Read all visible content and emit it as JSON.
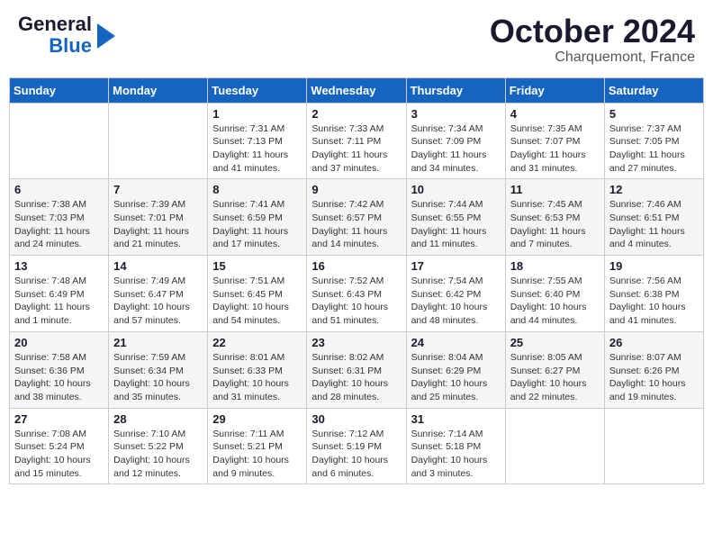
{
  "header": {
    "logo_general": "General",
    "logo_blue": "Blue",
    "month_title": "October 2024",
    "location": "Charquemont, France"
  },
  "days_of_week": [
    "Sunday",
    "Monday",
    "Tuesday",
    "Wednesday",
    "Thursday",
    "Friday",
    "Saturday"
  ],
  "weeks": [
    [
      {
        "day": "",
        "info": ""
      },
      {
        "day": "",
        "info": ""
      },
      {
        "day": "1",
        "info": "Sunrise: 7:31 AM\nSunset: 7:13 PM\nDaylight: 11 hours and 41 minutes."
      },
      {
        "day": "2",
        "info": "Sunrise: 7:33 AM\nSunset: 7:11 PM\nDaylight: 11 hours and 37 minutes."
      },
      {
        "day": "3",
        "info": "Sunrise: 7:34 AM\nSunset: 7:09 PM\nDaylight: 11 hours and 34 minutes."
      },
      {
        "day": "4",
        "info": "Sunrise: 7:35 AM\nSunset: 7:07 PM\nDaylight: 11 hours and 31 minutes."
      },
      {
        "day": "5",
        "info": "Sunrise: 7:37 AM\nSunset: 7:05 PM\nDaylight: 11 hours and 27 minutes."
      }
    ],
    [
      {
        "day": "6",
        "info": "Sunrise: 7:38 AM\nSunset: 7:03 PM\nDaylight: 11 hours and 24 minutes."
      },
      {
        "day": "7",
        "info": "Sunrise: 7:39 AM\nSunset: 7:01 PM\nDaylight: 11 hours and 21 minutes."
      },
      {
        "day": "8",
        "info": "Sunrise: 7:41 AM\nSunset: 6:59 PM\nDaylight: 11 hours and 17 minutes."
      },
      {
        "day": "9",
        "info": "Sunrise: 7:42 AM\nSunset: 6:57 PM\nDaylight: 11 hours and 14 minutes."
      },
      {
        "day": "10",
        "info": "Sunrise: 7:44 AM\nSunset: 6:55 PM\nDaylight: 11 hours and 11 minutes."
      },
      {
        "day": "11",
        "info": "Sunrise: 7:45 AM\nSunset: 6:53 PM\nDaylight: 11 hours and 7 minutes."
      },
      {
        "day": "12",
        "info": "Sunrise: 7:46 AM\nSunset: 6:51 PM\nDaylight: 11 hours and 4 minutes."
      }
    ],
    [
      {
        "day": "13",
        "info": "Sunrise: 7:48 AM\nSunset: 6:49 PM\nDaylight: 11 hours and 1 minute."
      },
      {
        "day": "14",
        "info": "Sunrise: 7:49 AM\nSunset: 6:47 PM\nDaylight: 10 hours and 57 minutes."
      },
      {
        "day": "15",
        "info": "Sunrise: 7:51 AM\nSunset: 6:45 PM\nDaylight: 10 hours and 54 minutes."
      },
      {
        "day": "16",
        "info": "Sunrise: 7:52 AM\nSunset: 6:43 PM\nDaylight: 10 hours and 51 minutes."
      },
      {
        "day": "17",
        "info": "Sunrise: 7:54 AM\nSunset: 6:42 PM\nDaylight: 10 hours and 48 minutes."
      },
      {
        "day": "18",
        "info": "Sunrise: 7:55 AM\nSunset: 6:40 PM\nDaylight: 10 hours and 44 minutes."
      },
      {
        "day": "19",
        "info": "Sunrise: 7:56 AM\nSunset: 6:38 PM\nDaylight: 10 hours and 41 minutes."
      }
    ],
    [
      {
        "day": "20",
        "info": "Sunrise: 7:58 AM\nSunset: 6:36 PM\nDaylight: 10 hours and 38 minutes."
      },
      {
        "day": "21",
        "info": "Sunrise: 7:59 AM\nSunset: 6:34 PM\nDaylight: 10 hours and 35 minutes."
      },
      {
        "day": "22",
        "info": "Sunrise: 8:01 AM\nSunset: 6:33 PM\nDaylight: 10 hours and 31 minutes."
      },
      {
        "day": "23",
        "info": "Sunrise: 8:02 AM\nSunset: 6:31 PM\nDaylight: 10 hours and 28 minutes."
      },
      {
        "day": "24",
        "info": "Sunrise: 8:04 AM\nSunset: 6:29 PM\nDaylight: 10 hours and 25 minutes."
      },
      {
        "day": "25",
        "info": "Sunrise: 8:05 AM\nSunset: 6:27 PM\nDaylight: 10 hours and 22 minutes."
      },
      {
        "day": "26",
        "info": "Sunrise: 8:07 AM\nSunset: 6:26 PM\nDaylight: 10 hours and 19 minutes."
      }
    ],
    [
      {
        "day": "27",
        "info": "Sunrise: 7:08 AM\nSunset: 5:24 PM\nDaylight: 10 hours and 15 minutes."
      },
      {
        "day": "28",
        "info": "Sunrise: 7:10 AM\nSunset: 5:22 PM\nDaylight: 10 hours and 12 minutes."
      },
      {
        "day": "29",
        "info": "Sunrise: 7:11 AM\nSunset: 5:21 PM\nDaylight: 10 hours and 9 minutes."
      },
      {
        "day": "30",
        "info": "Sunrise: 7:12 AM\nSunset: 5:19 PM\nDaylight: 10 hours and 6 minutes."
      },
      {
        "day": "31",
        "info": "Sunrise: 7:14 AM\nSunset: 5:18 PM\nDaylight: 10 hours and 3 minutes."
      },
      {
        "day": "",
        "info": ""
      },
      {
        "day": "",
        "info": ""
      }
    ]
  ]
}
